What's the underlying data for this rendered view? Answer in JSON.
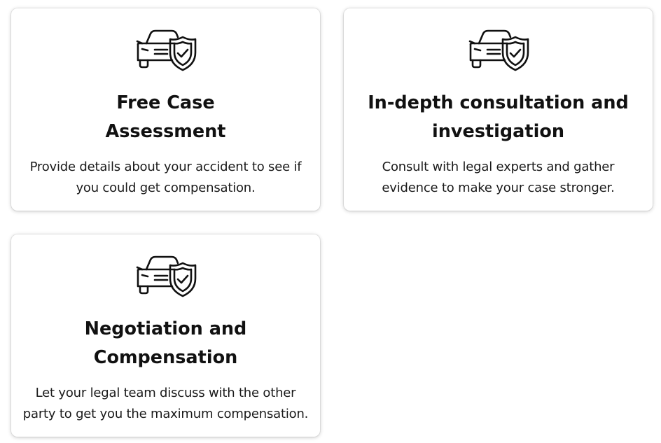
{
  "cards": [
    {
      "icon": "car-shield-check-icon",
      "title_lines": [
        "Free Case",
        "Assessment"
      ],
      "description_lines": [
        "Provide details about your accident to see if",
        "you could get compensation."
      ]
    },
    {
      "icon": "car-shield-check-icon",
      "title_lines": [
        "In-depth consultation and",
        "investigation"
      ],
      "description_lines": [
        "Consult with legal experts and gather",
        "evidence to make your case stronger."
      ]
    },
    {
      "icon": "car-shield-check-icon",
      "title_lines": [
        "Negotiation and",
        "Compensation"
      ],
      "description_lines": [
        "Let your legal team discuss with the other",
        "party to get you the maximum compensation."
      ]
    }
  ],
  "colors": {
    "text": "#111111",
    "card_background": "#ffffff",
    "icon_stroke": "#111111"
  }
}
